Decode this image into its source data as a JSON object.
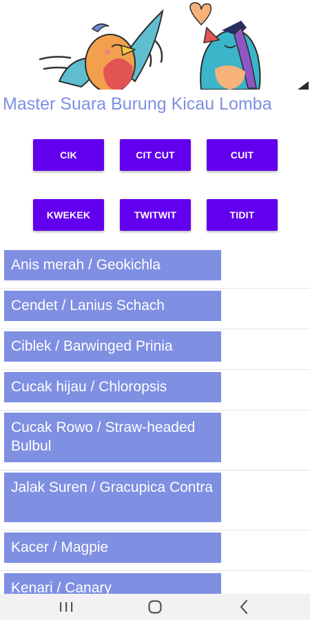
{
  "app": {
    "title": "Master Suara Burung Kicau Lomba"
  },
  "sound_buttons": [
    {
      "label": "CIK"
    },
    {
      "label": "CIT CUT"
    },
    {
      "label": "CUIT"
    },
    {
      "label": "KWEKEK"
    },
    {
      "label": "TWITWIT"
    },
    {
      "label": "TIDIT"
    }
  ],
  "bird_list": [
    {
      "label": "Anis merah / Geokichla"
    },
    {
      "label": "Cendet / Lanius Schach"
    },
    {
      "label": "Ciblek / Barwinged Prinia"
    },
    {
      "label": "Cucak hijau / Chloropsis"
    },
    {
      "label": "Cucak Rowo / Straw-headed Bulbul"
    },
    {
      "label": "Jalak Suren / Gracupica Contra"
    },
    {
      "label": "Kacer / Magpie"
    },
    {
      "label": "Kenari / Canary"
    }
  ],
  "colors": {
    "button_bg": "#6200ee",
    "list_item_bg": "#7f8fe2",
    "title_text": "#7e8ee3"
  },
  "icons": {
    "banner": "cartoon-birds-illustration",
    "nav_recent": "recent-apps-icon",
    "nav_home": "home-icon",
    "nav_back": "back-icon"
  }
}
